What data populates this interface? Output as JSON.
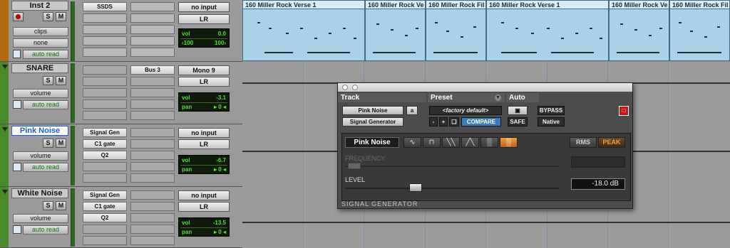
{
  "tracks": [
    {
      "name": "Inst 2",
      "solo": "S",
      "mute": "M",
      "view": "clips",
      "sub": "none",
      "auto": "auto read",
      "inserts": [
        "SSDS",
        "",
        "",
        "",
        ""
      ],
      "sends": [],
      "io_in": "no input",
      "io_out": "LR",
      "lcd": {
        "k1": "vol",
        "v1": "0.0",
        "k2": "‹100",
        "v2": "100›"
      }
    },
    {
      "name": "SNARE",
      "solo": "S",
      "mute": "M",
      "view": "volume",
      "auto": "auto read",
      "inserts": [
        "",
        "",
        "",
        "",
        ""
      ],
      "sends": [
        "Bus 3"
      ],
      "io_in": "Mono 9",
      "io_out": "LR",
      "lcd": {
        "k1": "vol",
        "v1": "-3.1",
        "k2": "pan",
        "v2": "▸ 0 ◂"
      }
    },
    {
      "name": "Pink Noise",
      "solo": "S",
      "mute": "M",
      "view": "volume",
      "auto": "auto read",
      "inserts": [
        "Signal Gen",
        "C1 gate",
        "Q2",
        "",
        ""
      ],
      "sends": [],
      "io_in": "no input",
      "io_out": "LR",
      "lcd": {
        "k1": "vol",
        "v1": "-6.7",
        "k2": "pan",
        "v2": "▸ 0 ◂"
      }
    },
    {
      "name": "White Noise",
      "solo": "S",
      "mute": "M",
      "view": "volume",
      "auto": "auto read",
      "inserts": [
        "Signal Gen",
        "C1 gate",
        "Q2",
        "",
        ""
      ],
      "sends": [],
      "io_in": "no input",
      "io_out": "LR",
      "lcd": {
        "k1": "vol",
        "v1": "-13.5",
        "k2": "pan",
        "v2": "▸ 0 ◂"
      }
    }
  ],
  "clips": [
    "160 Miller Rock Verse 1",
    "160 Miller Rock Ve",
    "160 Miller Rock Fil",
    "160 Miller Rock Verse 1",
    "160 Miller Rock Ve",
    "160 Miller Rock Fil"
  ],
  "plugin": {
    "hdr_track": "Track",
    "hdr_preset": "Preset",
    "hdr_auto": "Auto",
    "track_name": "Pink Noise",
    "track_letter": "a",
    "plugin_name": "Signal Generator",
    "preset_name": "<factory default>",
    "minus": "-",
    "plus": "+",
    "compare": "COMPARE",
    "bypass": "BYPASS",
    "safe": "SAFE",
    "native": "Native",
    "signal_label": "Pink Noise",
    "rms": "RMS",
    "peak": "PEAK",
    "frequency_label": "FREQUENCY",
    "level_label": "LEVEL",
    "level_value": "-18.0 dB",
    "footer": "SIGNAL GENERATOR",
    "waveforms": [
      "∿",
      "⊓",
      "╲╲",
      "╱╲",
      "▒",
      "▒"
    ]
  },
  "colors": {
    "clip": "#a9d2e6",
    "lcd_text": "#56e02b",
    "selected_name": "#1a5fd0",
    "peak_active": "#f1a03c"
  }
}
